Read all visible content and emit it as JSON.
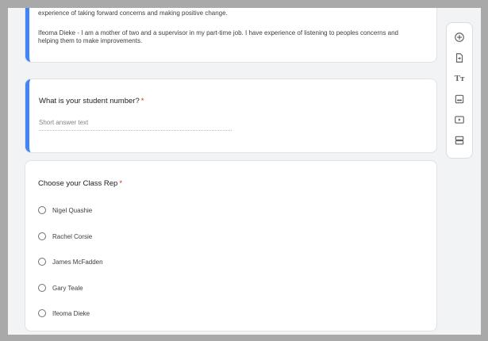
{
  "top_card": {
    "line1": "experience of taking forward concerns and making positive change.",
    "line2": "Ifeoma Dieke - I am a mother of two and a supervisor in my part-time job. I have experience of listening to peoples concerns and helping them to make improvements."
  },
  "student_question": {
    "title": "What is your student number?",
    "required_mark": "*",
    "placeholder": "Short answer text"
  },
  "rep_question": {
    "title": "Choose your Class Rep",
    "required_mark": "*",
    "options": [
      "Nigel Quashie",
      "Rachel Corsie",
      "James McFadden",
      "Gary Teale",
      "Ifeoma Dieke"
    ]
  },
  "toolbar": {
    "items": [
      "add-question-icon",
      "import-questions-icon",
      "add-title-icon",
      "add-image-icon",
      "add-video-icon",
      "add-section-icon"
    ],
    "title_glyph": "Tт"
  },
  "colors": {
    "accent": "#4285f4",
    "required": "#d93025",
    "page_bg": "#f1f3f4"
  }
}
